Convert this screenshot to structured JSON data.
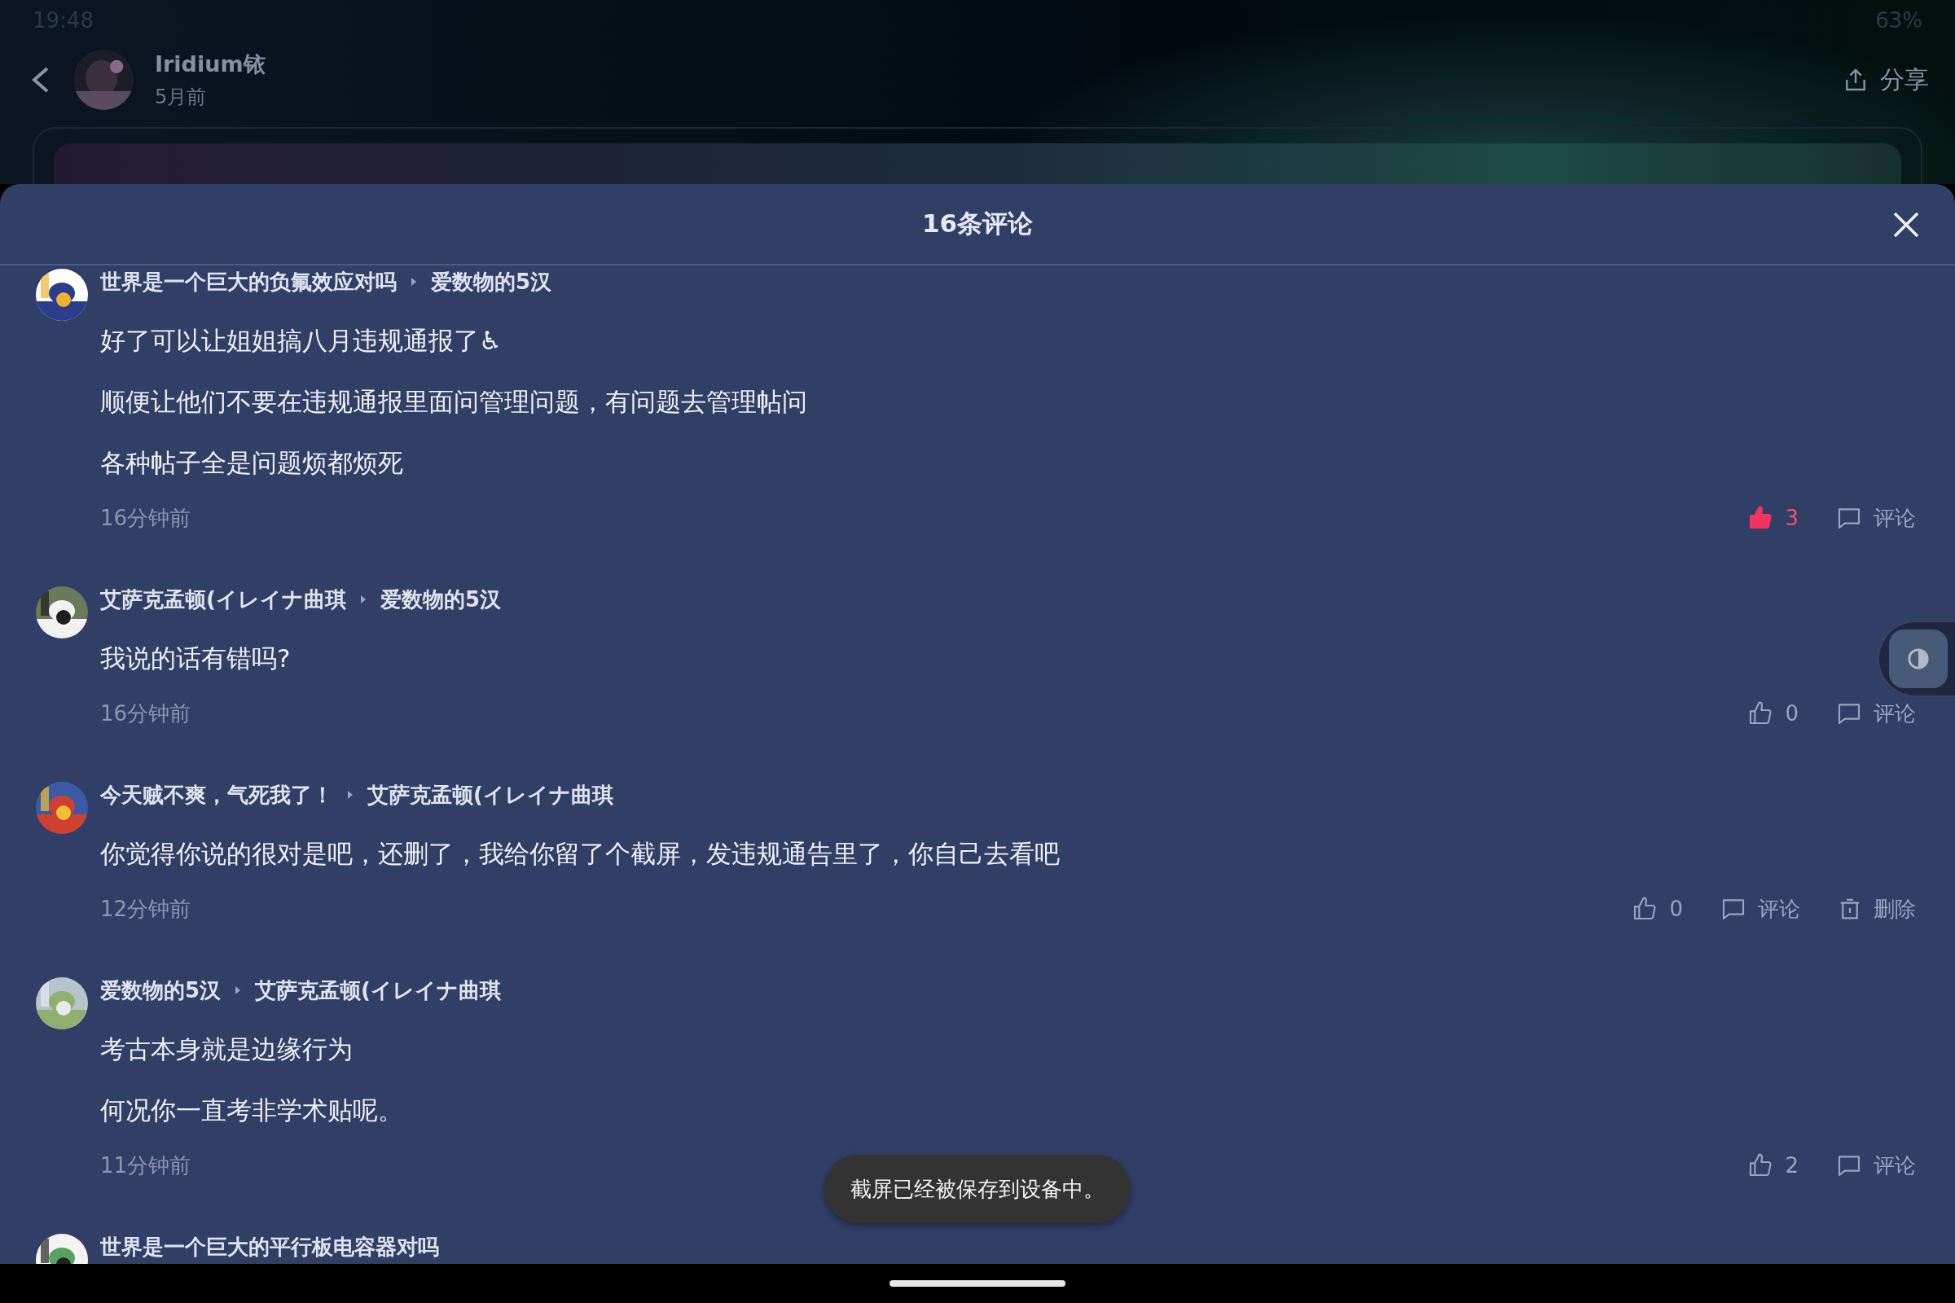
{
  "status_bar": {
    "time": "19:48",
    "battery": "63%"
  },
  "header": {
    "author": "Iridium铱",
    "time": "5月前",
    "share": "分享"
  },
  "sheet": {
    "title": "16条评论"
  },
  "comments": [
    {
      "name": "世界是一个巨大的负氟效应对吗",
      "reply_to": "爱数物的5汉",
      "lines": [
        "好了可以让姐姐搞八月违规通报了♿",
        "顺便让他们不要在违规通报里面问管理问题，有问题去管理帖问",
        "各种帖子全是问题烦都烦死"
      ],
      "time": "16分钟前",
      "actions": [
        {
          "kind": "like",
          "label": "3",
          "liked": true
        },
        {
          "kind": "comment",
          "label": "评论"
        }
      ]
    },
    {
      "name": "艾萨克孟顿(イレイナ曲琪",
      "reply_to": "爱数物的5汉",
      "lines": [
        "我说的话有错吗?"
      ],
      "time": "16分钟前",
      "actions": [
        {
          "kind": "like",
          "label": "0",
          "liked": false
        },
        {
          "kind": "comment",
          "label": "评论"
        }
      ]
    },
    {
      "name": "今天贼不爽，气死我了！",
      "reply_to": "艾萨克孟顿(イレイナ曲琪",
      "lines": [
        "你觉得你说的很对是吧，还删了，我给你留了个截屏，发违规通告里了，你自己去看吧"
      ],
      "time": "12分钟前",
      "actions": [
        {
          "kind": "like",
          "label": "0",
          "liked": false
        },
        {
          "kind": "comment",
          "label": "评论"
        },
        {
          "kind": "delete",
          "label": "删除"
        }
      ]
    },
    {
      "name": "爱数物的5汉",
      "reply_to": "艾萨克孟顿(イレイナ曲琪",
      "lines": [
        "考古本身就是边缘行为",
        "何况你一直考非学术贴呢。"
      ],
      "time": "11分钟前",
      "actions": [
        {
          "kind": "like",
          "label": "2",
          "liked": false
        },
        {
          "kind": "comment",
          "label": "评论"
        }
      ]
    },
    {
      "name": "世界是一个巨大的平行板电容器对吗"
    }
  ],
  "toast": "截屏已经被保存到设备中。"
}
